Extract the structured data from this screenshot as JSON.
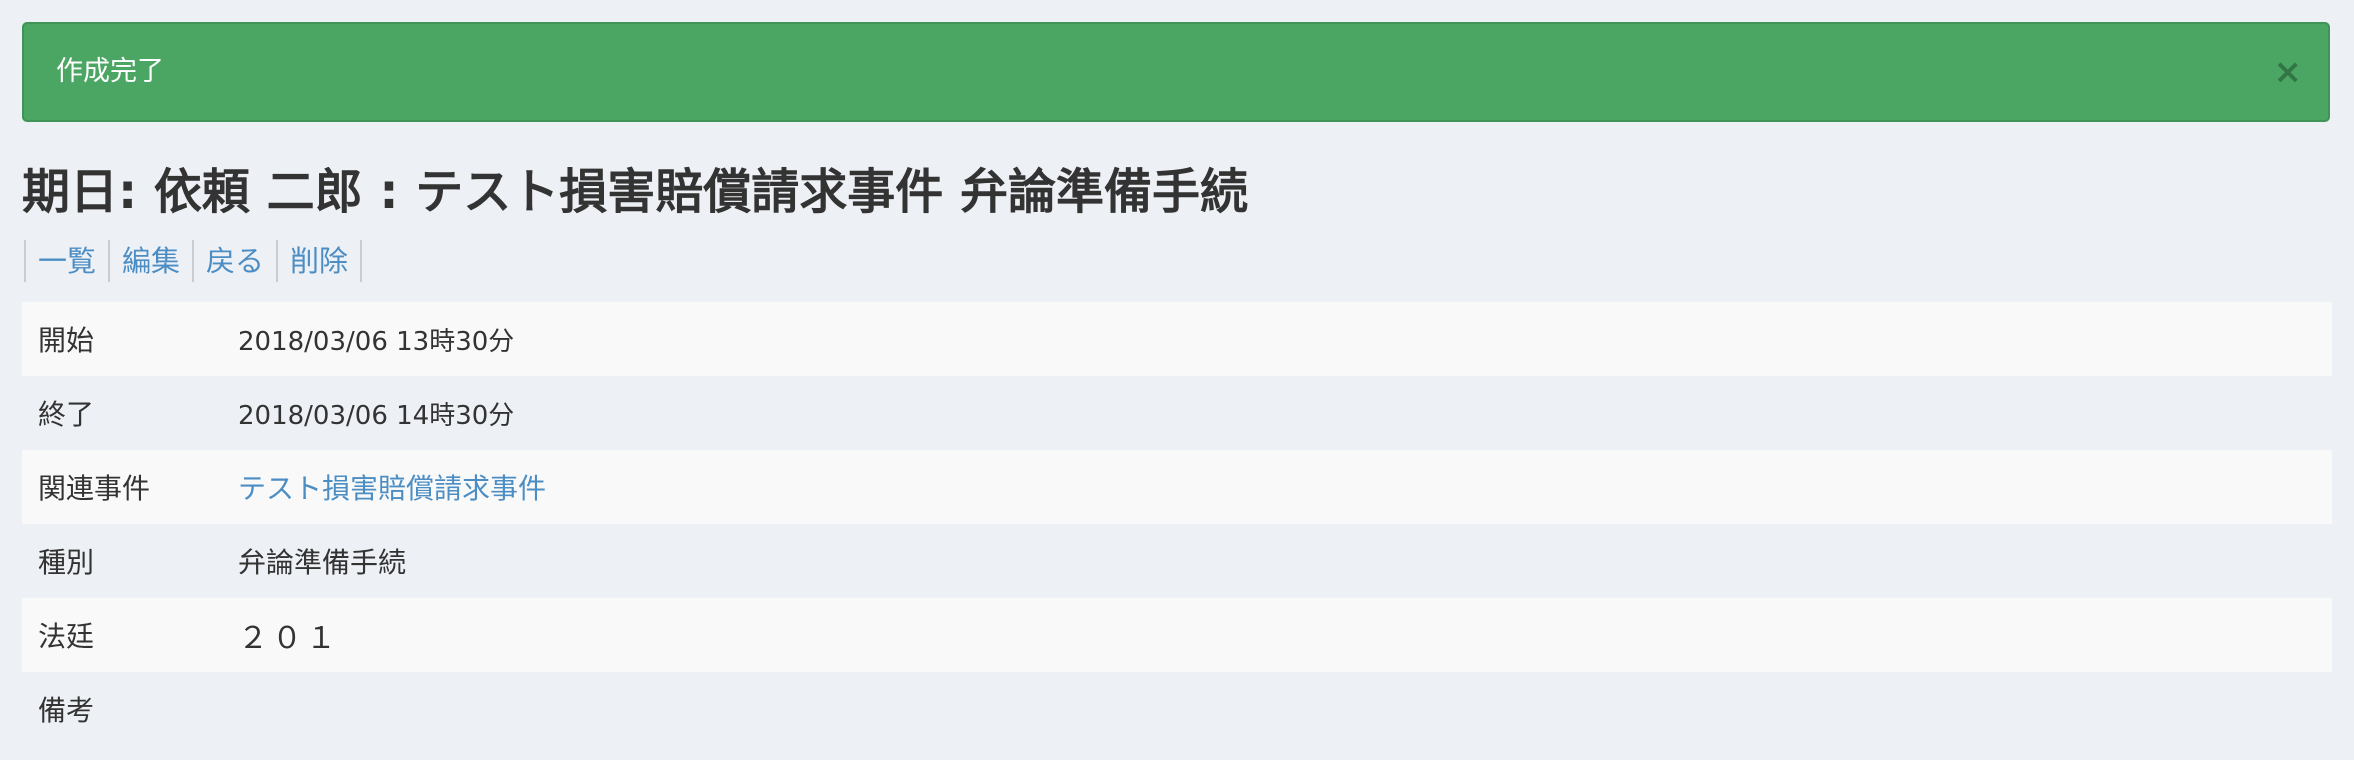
{
  "alert": {
    "message": "作成完了",
    "close_label": "×"
  },
  "page": {
    "title": "期日: 依頼 二郎 : テスト損害賠償請求事件 弁論準備手続"
  },
  "actions": [
    {
      "label": "一覧"
    },
    {
      "label": "編集"
    },
    {
      "label": "戻る"
    },
    {
      "label": "削除"
    }
  ],
  "details": {
    "start": {
      "label": "開始",
      "value": "2018/03/06 13時30分"
    },
    "end": {
      "label": "終了",
      "value": "2018/03/06 14時30分"
    },
    "related_case": {
      "label": "関連事件",
      "value": "テスト損害賠償請求事件"
    },
    "type": {
      "label": "種別",
      "value": "弁論準備手続"
    },
    "court": {
      "label": "法廷",
      "value": "２０１"
    },
    "notes": {
      "label": "備考",
      "value": ""
    }
  }
}
